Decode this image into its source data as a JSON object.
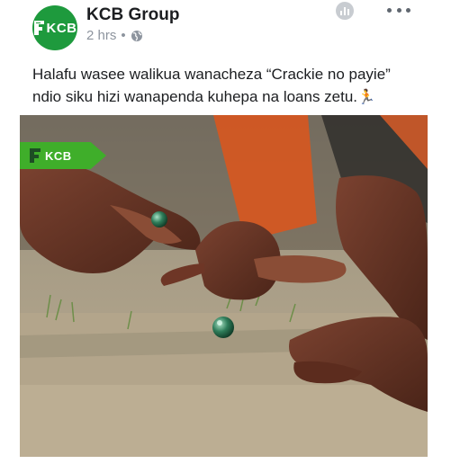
{
  "post": {
    "page_name": "KCB Group",
    "timestamp": "2 hrs",
    "separator": "•",
    "privacy_icon": "globe-icon",
    "text_line1": "Halafu wasee walikua wanacheza “Crackie no payie”",
    "text_line2": "ndio siku hizi wanapenda kuhepa na loans zetu.",
    "emoji": "🏃"
  },
  "avatar": {
    "logo_text": "KCB",
    "color": "#1e9a3d"
  },
  "photo": {
    "tag_text": "KCB",
    "tag_color": "#3fae2a",
    "description_icon": "marbles-photo"
  },
  "icons": {
    "insights": "insights-icon",
    "more": "more-options-icon"
  }
}
